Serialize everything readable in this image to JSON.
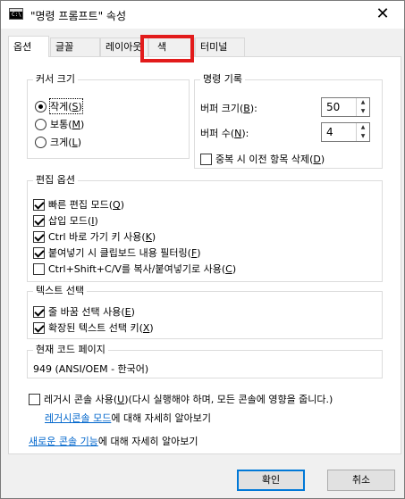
{
  "titlebar": {
    "app_icon_text": "C:\\",
    "title": "\"명령 프롬프트\" 속성",
    "close_glyph": "✕"
  },
  "tabs": [
    "옵션",
    "글꼴",
    "레이아웃",
    "색",
    "터미널"
  ],
  "cursor_size": {
    "legend": "커서 크기",
    "options": [
      {
        "label": "작게",
        "key": "S",
        "checked": true
      },
      {
        "label": "보통",
        "key": "M",
        "checked": false
      },
      {
        "label": "크게",
        "key": "L",
        "checked": false
      }
    ]
  },
  "command_history": {
    "legend": "명령 기록",
    "buffer_size": {
      "label": "버퍼 크기",
      "key": "B",
      "value": "50"
    },
    "buffer_count": {
      "label": "버퍼 수",
      "key": "N",
      "value": "4"
    },
    "discard_dupes": {
      "label": "중복 시 이전 항목 삭제",
      "key": "D",
      "checked": false
    }
  },
  "edit_options": {
    "legend": "편집 옵션",
    "items": [
      {
        "label": "빠른 편집 모드",
        "key": "Q",
        "checked": true
      },
      {
        "label": "삽입 모드",
        "key": "I",
        "checked": true
      },
      {
        "label": "Ctrl 바로 가기 키 사용",
        "key": "K",
        "checked": true
      },
      {
        "label": "붙여넣기 시 클립보드 내용 필터링",
        "key": "F",
        "checked": true
      },
      {
        "label": "Ctrl+Shift+C/V를 복사/붙여넣기로 사용",
        "key": "C",
        "checked": false
      }
    ]
  },
  "text_selection": {
    "legend": "텍스트 선택",
    "items": [
      {
        "label": "줄 바꿈 선택 사용",
        "key": "E",
        "checked": true
      },
      {
        "label": "확장된 텍스트 선택 키",
        "key": "X",
        "checked": true
      }
    ]
  },
  "code_page": {
    "legend": "현재 코드 페이지",
    "value": "949   (ANSI/OEM - 한국어)"
  },
  "legacy": {
    "checkbox_label": "레거시 콘솔 사용",
    "key": "U",
    "checkbox_suffix": "(다시 실행해야 하며, 모든 콘솔에 영향을 줍니다.)",
    "link_text": "레거시콘솔 모드",
    "link_suffix": "에 대해 자세히 알아보기",
    "checked": false
  },
  "new_console": {
    "link_text": "새로운 콘솔 기능",
    "suffix": "에 대해 자세히 알아보기"
  },
  "buttons": {
    "ok": "확인",
    "cancel": "취소"
  },
  "colors": {
    "highlight": "#e21b1b",
    "link": "#0066cc",
    "default_button_border": "#0078d7"
  }
}
